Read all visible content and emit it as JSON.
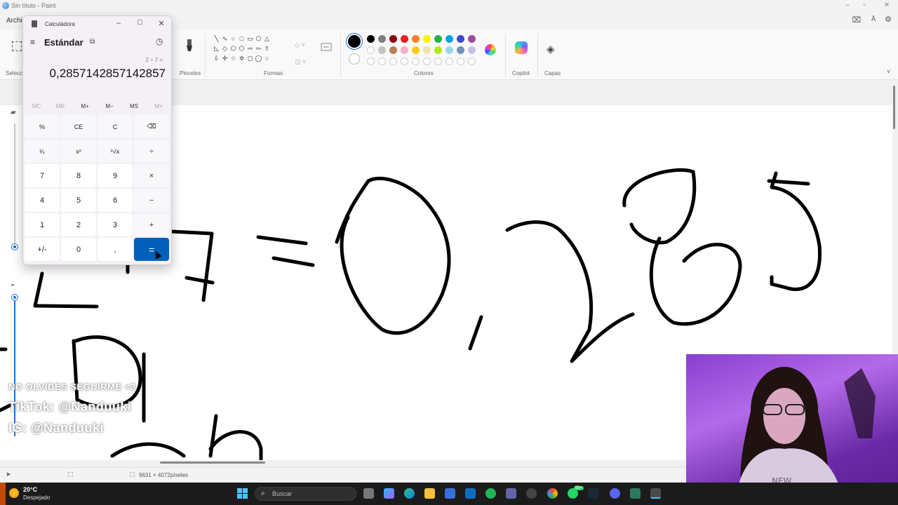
{
  "paint": {
    "window_title": "Sin título - Paint",
    "menu_file": "Archi",
    "ribbon": {
      "groups": {
        "selection": "Selecci",
        "brushes": "Pinceles",
        "shapes": "Formas",
        "colors": "Colores",
        "copilot": "Copilot",
        "layers": "Capas"
      },
      "shape_glyphs": [
        "╲",
        "∿",
        "○",
        "□",
        "▭",
        "⬠",
        "△",
        "",
        "",
        "◺",
        "◇",
        "⬠",
        "⬡",
        "⇨",
        "⇦",
        "⇧",
        "",
        "",
        "⇩",
        "✢",
        "☆",
        "✡",
        "◻",
        "◯",
        "○",
        "",
        ""
      ],
      "palette_row1": [
        "#000000",
        "#7f7f7f",
        "#880015",
        "#ed1c24",
        "#ff7f27",
        "#fff200",
        "#22b14c",
        "#00a2e8",
        "#3f48cc",
        "#a349a4"
      ],
      "palette_row2": [
        "#ffffff",
        "#c3c3c3",
        "#b97a57",
        "#ffaec9",
        "#ffc90e",
        "#efe4b0",
        "#b5e61d",
        "#99d9ea",
        "#7092be",
        "#c8bfe7"
      ],
      "current_color": "#000000",
      "secondary_color": "#ffffff"
    },
    "status": {
      "canvas_size": "9631 × 4072píxeles"
    },
    "overlay": {
      "line1": "NO OLVIDES SEGUIRME <3",
      "line2": "TikTok: @Nanduuki",
      "line3": "IG: @Nanduuki"
    }
  },
  "calculator": {
    "title": "Calculadora",
    "mode": "Estándar",
    "expression": "2 ÷ 7 =",
    "display": "0,2857142857142857",
    "memory": [
      "MC",
      "MR",
      "M+",
      "M−",
      "MS",
      "M˅"
    ],
    "keys": [
      "%",
      "CE",
      "C",
      "⌫",
      "¹⁄ₓ",
      "x²",
      "²√x",
      "÷",
      "7",
      "8",
      "9",
      "×",
      "4",
      "5",
      "6",
      "−",
      "1",
      "2",
      "3",
      "+",
      "+/-",
      "0",
      ",",
      "="
    ]
  },
  "taskbar": {
    "temperature": "20°C",
    "weather": "Despejado",
    "search_placeholder": "Buscar",
    "whatsapp_badge": "99+"
  }
}
